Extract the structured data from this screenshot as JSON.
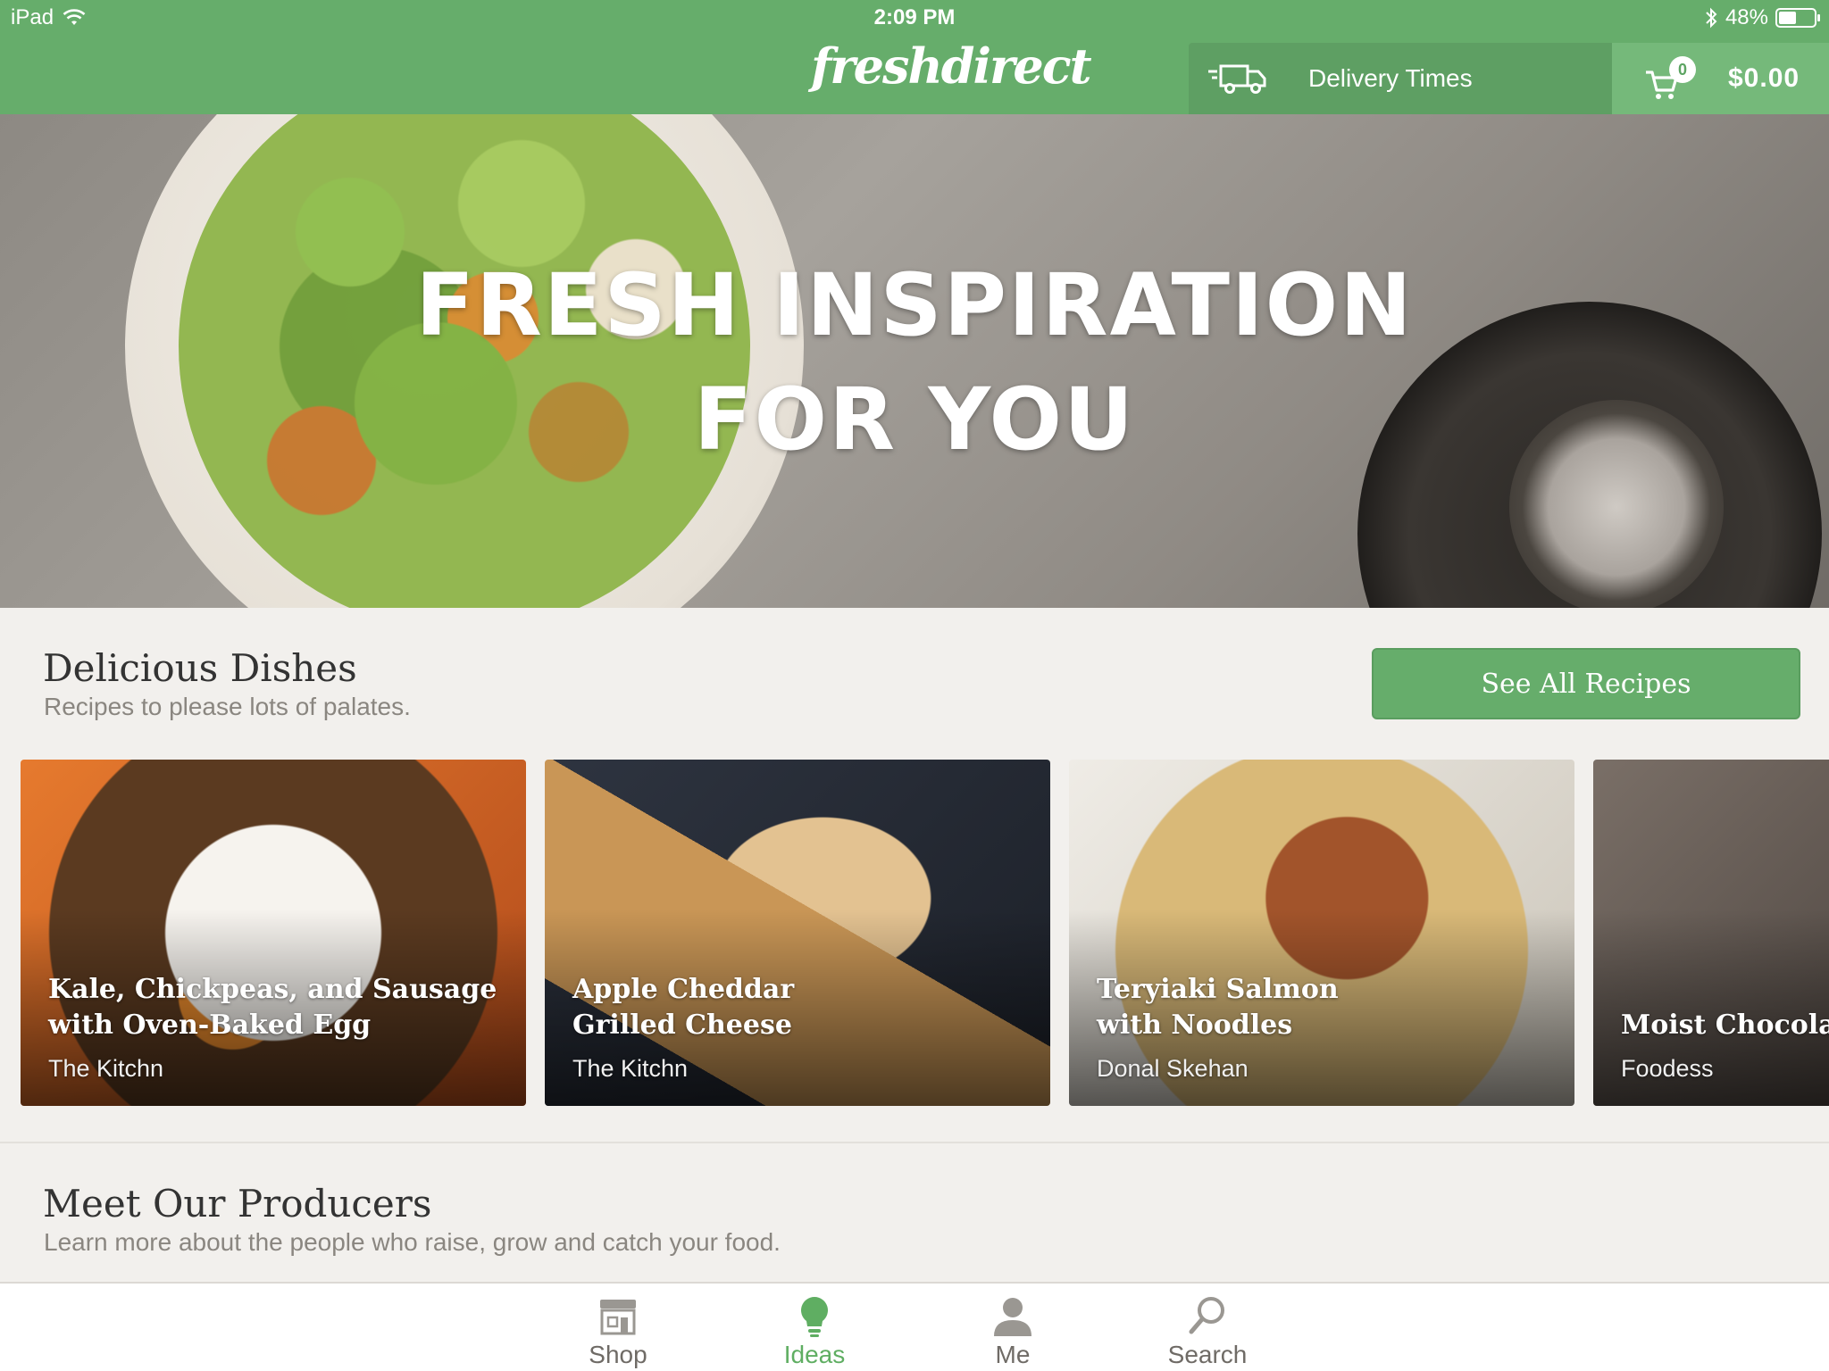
{
  "status_bar": {
    "device": "iPad",
    "time": "2:09 PM",
    "battery": "48%",
    "battery_level": 0.48
  },
  "header": {
    "logo": "freshdirect",
    "delivery_label": "Delivery Times",
    "cart_count": "0",
    "cart_total": "$0.00",
    "brand_color": "#66ad6b"
  },
  "hero": {
    "line1": "FRESH INSPIRATION",
    "line2": "FOR YOU"
  },
  "dishes": {
    "title": "Delicious Dishes",
    "subtitle": "Recipes to please lots of palates.",
    "see_all_label": "See All Recipes",
    "cards": [
      {
        "title_line1": "Kale, Chickpeas, and Sausage",
        "title_line2": "with Oven-Baked Egg",
        "source": "The Kitchn"
      },
      {
        "title_line1": "Apple Cheddar",
        "title_line2": "Grilled Cheese",
        "source": "The Kitchn"
      },
      {
        "title_line1": "Teryiaki Salmon",
        "title_line2": "with Noodles",
        "source": "Donal Skehan"
      },
      {
        "title_line1": "",
        "title_line2": "Moist Chocolat",
        "source": "Foodess"
      }
    ]
  },
  "producers": {
    "title": "Meet Our Producers",
    "subtitle": "Learn more about the people who raise, grow and catch your food."
  },
  "tabs": [
    {
      "label": "Shop",
      "icon": "storefront-icon"
    },
    {
      "label": "Ideas",
      "icon": "lightbulb-icon",
      "active": true
    },
    {
      "label": "Me",
      "icon": "person-icon"
    },
    {
      "label": "Search",
      "icon": "magnifier-icon"
    }
  ]
}
